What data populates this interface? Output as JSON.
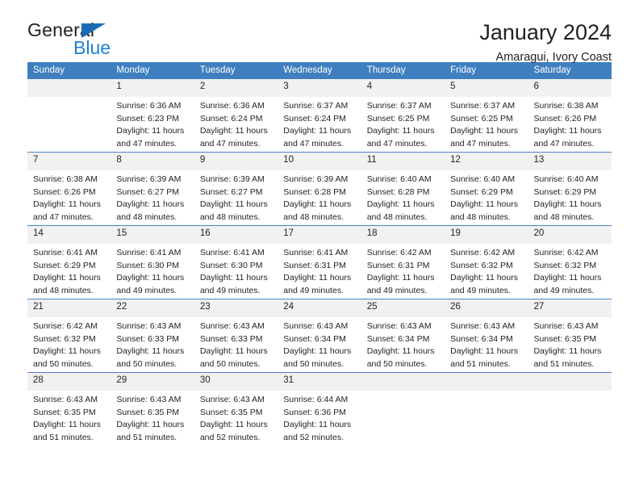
{
  "brand": {
    "name_primary": "General",
    "name_secondary": "Blue",
    "triangle_icon": "triangle-icon",
    "accent_color": "#1f7fd1"
  },
  "header": {
    "title": "January 2024",
    "subtitle": "Amaragui, Ivory Coast"
  },
  "calendar": {
    "header_color": "#3f7fbf",
    "daynum_bg": "#f1f1f1",
    "weekdays": [
      "Sunday",
      "Monday",
      "Tuesday",
      "Wednesday",
      "Thursday",
      "Friday",
      "Saturday"
    ],
    "weeks": [
      [
        {
          "day": "",
          "empty": true,
          "sunrise": "",
          "sunset": "",
          "daylight_line1": "",
          "daylight_line2": ""
        },
        {
          "day": "1",
          "sunrise": "Sunrise: 6:36 AM",
          "sunset": "Sunset: 6:23 PM",
          "daylight_line1": "Daylight: 11 hours",
          "daylight_line2": "and 47 minutes."
        },
        {
          "day": "2",
          "sunrise": "Sunrise: 6:36 AM",
          "sunset": "Sunset: 6:24 PM",
          "daylight_line1": "Daylight: 11 hours",
          "daylight_line2": "and 47 minutes."
        },
        {
          "day": "3",
          "sunrise": "Sunrise: 6:37 AM",
          "sunset": "Sunset: 6:24 PM",
          "daylight_line1": "Daylight: 11 hours",
          "daylight_line2": "and 47 minutes."
        },
        {
          "day": "4",
          "sunrise": "Sunrise: 6:37 AM",
          "sunset": "Sunset: 6:25 PM",
          "daylight_line1": "Daylight: 11 hours",
          "daylight_line2": "and 47 minutes."
        },
        {
          "day": "5",
          "sunrise": "Sunrise: 6:37 AM",
          "sunset": "Sunset: 6:25 PM",
          "daylight_line1": "Daylight: 11 hours",
          "daylight_line2": "and 47 minutes."
        },
        {
          "day": "6",
          "sunrise": "Sunrise: 6:38 AM",
          "sunset": "Sunset: 6:26 PM",
          "daylight_line1": "Daylight: 11 hours",
          "daylight_line2": "and 47 minutes."
        }
      ],
      [
        {
          "day": "7",
          "sunrise": "Sunrise: 6:38 AM",
          "sunset": "Sunset: 6:26 PM",
          "daylight_line1": "Daylight: 11 hours",
          "daylight_line2": "and 47 minutes."
        },
        {
          "day": "8",
          "sunrise": "Sunrise: 6:39 AM",
          "sunset": "Sunset: 6:27 PM",
          "daylight_line1": "Daylight: 11 hours",
          "daylight_line2": "and 48 minutes."
        },
        {
          "day": "9",
          "sunrise": "Sunrise: 6:39 AM",
          "sunset": "Sunset: 6:27 PM",
          "daylight_line1": "Daylight: 11 hours",
          "daylight_line2": "and 48 minutes."
        },
        {
          "day": "10",
          "sunrise": "Sunrise: 6:39 AM",
          "sunset": "Sunset: 6:28 PM",
          "daylight_line1": "Daylight: 11 hours",
          "daylight_line2": "and 48 minutes."
        },
        {
          "day": "11",
          "sunrise": "Sunrise: 6:40 AM",
          "sunset": "Sunset: 6:28 PM",
          "daylight_line1": "Daylight: 11 hours",
          "daylight_line2": "and 48 minutes."
        },
        {
          "day": "12",
          "sunrise": "Sunrise: 6:40 AM",
          "sunset": "Sunset: 6:29 PM",
          "daylight_line1": "Daylight: 11 hours",
          "daylight_line2": "and 48 minutes."
        },
        {
          "day": "13",
          "sunrise": "Sunrise: 6:40 AM",
          "sunset": "Sunset: 6:29 PM",
          "daylight_line1": "Daylight: 11 hours",
          "daylight_line2": "and 48 minutes."
        }
      ],
      [
        {
          "day": "14",
          "sunrise": "Sunrise: 6:41 AM",
          "sunset": "Sunset: 6:29 PM",
          "daylight_line1": "Daylight: 11 hours",
          "daylight_line2": "and 48 minutes."
        },
        {
          "day": "15",
          "sunrise": "Sunrise: 6:41 AM",
          "sunset": "Sunset: 6:30 PM",
          "daylight_line1": "Daylight: 11 hours",
          "daylight_line2": "and 49 minutes."
        },
        {
          "day": "16",
          "sunrise": "Sunrise: 6:41 AM",
          "sunset": "Sunset: 6:30 PM",
          "daylight_line1": "Daylight: 11 hours",
          "daylight_line2": "and 49 minutes."
        },
        {
          "day": "17",
          "sunrise": "Sunrise: 6:41 AM",
          "sunset": "Sunset: 6:31 PM",
          "daylight_line1": "Daylight: 11 hours",
          "daylight_line2": "and 49 minutes."
        },
        {
          "day": "18",
          "sunrise": "Sunrise: 6:42 AM",
          "sunset": "Sunset: 6:31 PM",
          "daylight_line1": "Daylight: 11 hours",
          "daylight_line2": "and 49 minutes."
        },
        {
          "day": "19",
          "sunrise": "Sunrise: 6:42 AM",
          "sunset": "Sunset: 6:32 PM",
          "daylight_line1": "Daylight: 11 hours",
          "daylight_line2": "and 49 minutes."
        },
        {
          "day": "20",
          "sunrise": "Sunrise: 6:42 AM",
          "sunset": "Sunset: 6:32 PM",
          "daylight_line1": "Daylight: 11 hours",
          "daylight_line2": "and 49 minutes."
        }
      ],
      [
        {
          "day": "21",
          "sunrise": "Sunrise: 6:42 AM",
          "sunset": "Sunset: 6:32 PM",
          "daylight_line1": "Daylight: 11 hours",
          "daylight_line2": "and 50 minutes."
        },
        {
          "day": "22",
          "sunrise": "Sunrise: 6:43 AM",
          "sunset": "Sunset: 6:33 PM",
          "daylight_line1": "Daylight: 11 hours",
          "daylight_line2": "and 50 minutes."
        },
        {
          "day": "23",
          "sunrise": "Sunrise: 6:43 AM",
          "sunset": "Sunset: 6:33 PM",
          "daylight_line1": "Daylight: 11 hours",
          "daylight_line2": "and 50 minutes."
        },
        {
          "day": "24",
          "sunrise": "Sunrise: 6:43 AM",
          "sunset": "Sunset: 6:34 PM",
          "daylight_line1": "Daylight: 11 hours",
          "daylight_line2": "and 50 minutes."
        },
        {
          "day": "25",
          "sunrise": "Sunrise: 6:43 AM",
          "sunset": "Sunset: 6:34 PM",
          "daylight_line1": "Daylight: 11 hours",
          "daylight_line2": "and 50 minutes."
        },
        {
          "day": "26",
          "sunrise": "Sunrise: 6:43 AM",
          "sunset": "Sunset: 6:34 PM",
          "daylight_line1": "Daylight: 11 hours",
          "daylight_line2": "and 51 minutes."
        },
        {
          "day": "27",
          "sunrise": "Sunrise: 6:43 AM",
          "sunset": "Sunset: 6:35 PM",
          "daylight_line1": "Daylight: 11 hours",
          "daylight_line2": "and 51 minutes."
        }
      ],
      [
        {
          "day": "28",
          "sunrise": "Sunrise: 6:43 AM",
          "sunset": "Sunset: 6:35 PM",
          "daylight_line1": "Daylight: 11 hours",
          "daylight_line2": "and 51 minutes."
        },
        {
          "day": "29",
          "sunrise": "Sunrise: 6:43 AM",
          "sunset": "Sunset: 6:35 PM",
          "daylight_line1": "Daylight: 11 hours",
          "daylight_line2": "and 51 minutes."
        },
        {
          "day": "30",
          "sunrise": "Sunrise: 6:43 AM",
          "sunset": "Sunset: 6:35 PM",
          "daylight_line1": "Daylight: 11 hours",
          "daylight_line2": "and 52 minutes."
        },
        {
          "day": "31",
          "sunrise": "Sunrise: 6:44 AM",
          "sunset": "Sunset: 6:36 PM",
          "daylight_line1": "Daylight: 11 hours",
          "daylight_line2": "and 52 minutes."
        },
        {
          "day": "",
          "empty": true,
          "sunrise": "",
          "sunset": "",
          "daylight_line1": "",
          "daylight_line2": ""
        },
        {
          "day": "",
          "empty": true,
          "sunrise": "",
          "sunset": "",
          "daylight_line1": "",
          "daylight_line2": ""
        },
        {
          "day": "",
          "empty": true,
          "sunrise": "",
          "sunset": "",
          "daylight_line1": "",
          "daylight_line2": ""
        }
      ]
    ]
  }
}
